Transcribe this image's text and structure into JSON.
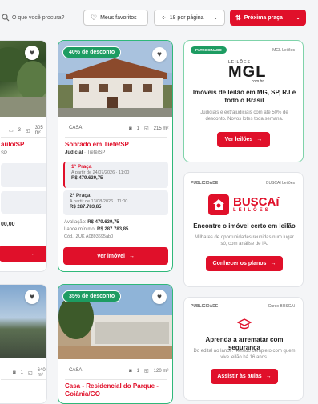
{
  "toolbar": {
    "search_placeholder": "O que você procura?",
    "favorites_label": "Meus favoritos",
    "per_page_label": "18 por página",
    "next_label": "Próxima praça"
  },
  "left_card_top": {
    "meta_rooms": "3",
    "meta_area": "305 m²",
    "title_partial": "aulo/SP",
    "city_partial": "SP",
    "price_partial": "00,00"
  },
  "main_card": {
    "discount": "40% de desconto",
    "type": "CASA",
    "rooms": "1",
    "area": "215 m²",
    "title": "Sobrado em Tietê/SP",
    "kind": "Judicial",
    "city": "Tietê/SP",
    "praca1": {
      "label": "1ª Praça",
      "date": "A partir de 24/07/2026 · 11:00",
      "value": "R$ 479.639,75"
    },
    "praca2": {
      "label": "2ª Praça",
      "date": "A partir de 13/08/2026 · 11:00",
      "value": "R$ 287.783,85"
    },
    "avaliacao_label": "Avaliação:",
    "avaliacao_value": "R$ 479.639,75",
    "lance_label": "Lance mínimo:",
    "lance_value": "R$ 287.783,85",
    "code": "Cód.: ZUK A0893695ab0",
    "button": "Ver imóvel"
  },
  "ad1": {
    "label": "PATROCINADO",
    "sponsor": "MGL Leilões",
    "logo_top": "LEILÕES",
    "logo_main": "MGL",
    "logo_sub": ".com.br",
    "title": "Imóveis de leilão em MG, SP, RJ e todo o Brasil",
    "desc": "Judiciais e extrajudiciais com até 50% de desconto. Novos lotes toda semana.",
    "button": "Ver leilões"
  },
  "ad2": {
    "label": "PUBLICIDADE",
    "sponsor": "BUSCAí Leilões",
    "logo_main": "BUSCAí",
    "logo_sub": "LEILÕES",
    "title": "Encontre o imóvel certo em leilão",
    "desc": "Milhares de oportunidades reunidas num lugar só, com análise de IA.",
    "button": "Conhecer os planos"
  },
  "ad3": {
    "label": "PUBLICIDADE",
    "sponsor": "Curso BUSCAí",
    "title": "Aprenda a arrematar com segurança",
    "desc": "Do edital ao lance: método completo com quem vive leilão há 16 anos.",
    "button": "Assistir às aulas"
  },
  "left_card_bottom": {
    "rooms": "1",
    "area": "640 m²"
  },
  "bottom_card": {
    "discount": "35% de desconto",
    "type": "CASA",
    "rooms": "1",
    "area": "120 m²",
    "title": "Casa - Residencial do Parque - Goiânia/GO"
  },
  "colors": {
    "brand_red": "#e0102a",
    "discount_green": "#1d9c62"
  }
}
